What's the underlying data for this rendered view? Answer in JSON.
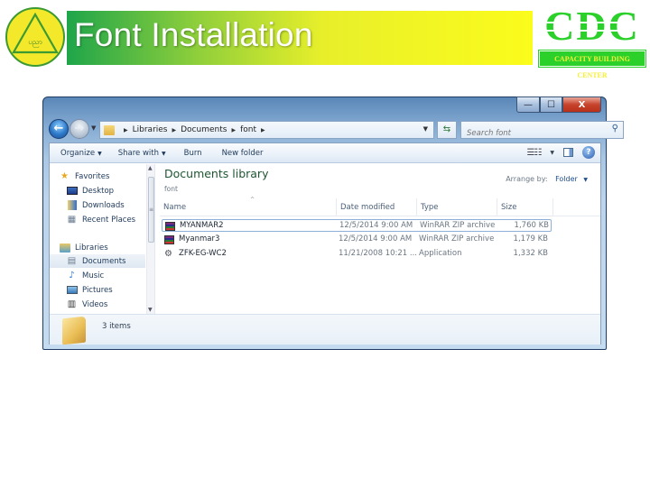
{
  "slide": {
    "title": "Font Installation",
    "logo_left_text": "ပညာ",
    "logo_right_letters": "CDC",
    "logo_right_sub": "CAPACITY BUILDING CENTER",
    "colors": {
      "title_gradient_start": "#1fa54a",
      "title_gradient_end": "#fbfc1c",
      "cdc_green": "#2bd12a",
      "logo_yellow": "#f3e92a"
    }
  },
  "window": {
    "controls": {
      "minimize": "—",
      "maximize": "☐",
      "close": "X"
    },
    "address": {
      "crumbs": [
        "Libraries",
        "Documents",
        "font"
      ]
    },
    "search": {
      "placeholder": "Search font"
    },
    "toolbar": {
      "organize": "Organize",
      "share_with": "Share with",
      "burn": "Burn",
      "new_folder": "New folder"
    },
    "nav": {
      "favorites": "Favorites",
      "desktop": "Desktop",
      "downloads": "Downloads",
      "recent_places": "Recent Places",
      "libraries": "Libraries",
      "documents": "Documents",
      "music": "Music",
      "pictures": "Pictures",
      "videos": "Videos"
    },
    "library": {
      "title": "Documents library",
      "subtitle": "font",
      "arrange_label": "Arrange by:",
      "arrange_value": "Folder"
    },
    "columns": {
      "name": "Name",
      "date": "Date modified",
      "type": "Type",
      "size": "Size"
    },
    "files": [
      {
        "name": "MYANMAR2",
        "date": "12/5/2014 9:00 AM",
        "type": "WinRAR ZIP archive",
        "size": "1,760 KB",
        "icon": "winrar-archive-icon"
      },
      {
        "name": "Myanmar3",
        "date": "12/5/2014 9:00 AM",
        "type": "WinRAR ZIP archive",
        "size": "1,179 KB",
        "icon": "winrar-archive-icon"
      },
      {
        "name": "ZFK-EG-WC2",
        "date": "11/21/2008 10:21 ...",
        "type": "Application",
        "size": "1,332 KB",
        "icon": "application-icon"
      }
    ],
    "status": {
      "items_count": "3 items"
    }
  }
}
